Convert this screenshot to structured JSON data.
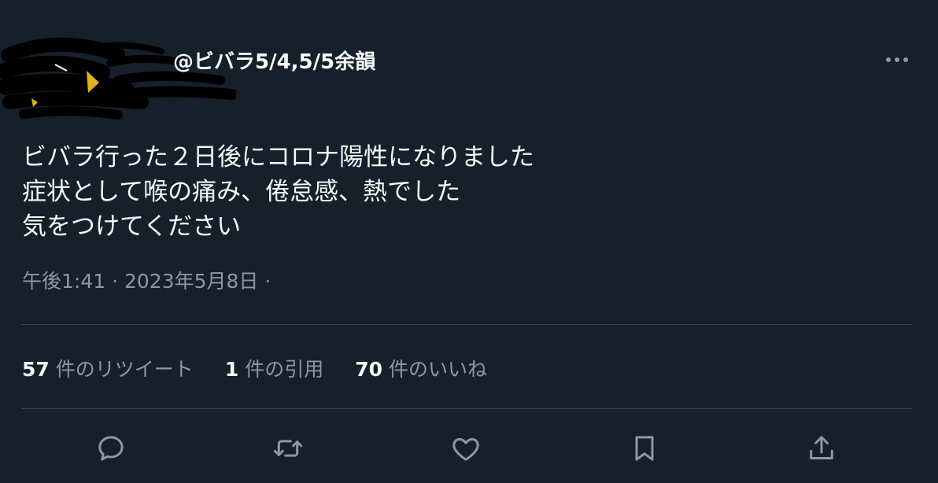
{
  "tweet": {
    "handle": "@ビバラ5/4,5/5余韻",
    "text_lines": [
      "ビバラ行った２日後にコロナ陽性になりました",
      "症状として喉の痛み、倦怠感、熱でした",
      "気をつけてください"
    ],
    "meta": "午後1:41 · 2023年5月8日 ·"
  },
  "stats": {
    "retweets_count": "57",
    "retweets_label": "件のリツイート",
    "quotes_count": "1",
    "quotes_label": "件の引用",
    "likes_count": "70",
    "likes_label": "件のいいね"
  },
  "icons": {
    "more": "more-icon",
    "reply": "reply-icon",
    "retweet": "retweet-icon",
    "like": "heart-icon",
    "bookmark": "bookmark-icon",
    "share": "share-icon"
  },
  "colors": {
    "background": "#15202b",
    "text": "#f7f9f9",
    "secondary": "#8b98a5",
    "divider": "#38444d"
  }
}
